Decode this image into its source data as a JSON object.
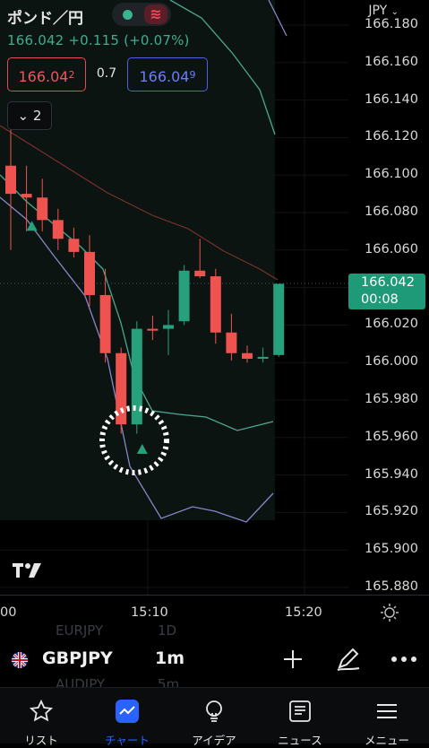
{
  "header": {
    "title": "ポンド／円",
    "price": "166.042",
    "change": "+0.115 (+0.07%)",
    "currency": "JPY",
    "sell_price": "166.04",
    "sell_price_sup": "2",
    "spread": "0.7",
    "buy_price": "166.04",
    "buy_price_sup": "9",
    "indicators_count": "2"
  },
  "colors": {
    "up": "#26a17b",
    "down": "#ef5350",
    "band_upper": "#4aa891",
    "band_lower": "#8b85c8",
    "mid": "#7a3030",
    "accent": "#2962ff"
  },
  "price_axis": {
    "ticks": [
      "166.180",
      "166.160",
      "166.140",
      "166.120",
      "166.100",
      "166.080",
      "166.060",
      "166.040",
      "166.020",
      "166.000",
      "165.980",
      "165.960",
      "165.940",
      "165.920",
      "165.900",
      "165.880"
    ],
    "current_price": "166.042",
    "countdown": "00:08"
  },
  "time_axis": {
    "ticks": [
      "00",
      "15:10",
      "15:20"
    ]
  },
  "toolbar": {
    "symbol": "GBPJPY",
    "interval": "1m",
    "ghost_symbol_above": "EURJPY",
    "ghost_interval_above": "1D",
    "ghost_symbol_below": "AUDJPY",
    "ghost_interval_below": "5m"
  },
  "tabs": [
    {
      "label": "リスト",
      "icon": "star-icon"
    },
    {
      "label": "チャート",
      "icon": "chart-icon",
      "active": true
    },
    {
      "label": "アイデア",
      "icon": "lightbulb-icon"
    },
    {
      "label": "ニュース",
      "icon": "news-icon"
    },
    {
      "label": "メニュー",
      "icon": "menu-icon"
    }
  ],
  "chart_data": {
    "type": "candlestick",
    "interval": "1m",
    "ylim": [
      165.875,
      166.185
    ],
    "candles": [
      {
        "o": 166.105,
        "h": 166.125,
        "l": 166.06,
        "c": 166.09
      },
      {
        "o": 166.09,
        "h": 166.105,
        "l": 166.07,
        "c": 166.088
      },
      {
        "o": 166.088,
        "h": 166.098,
        "l": 166.07,
        "c": 166.076
      },
      {
        "o": 166.076,
        "h": 166.082,
        "l": 166.06,
        "c": 166.066
      },
      {
        "o": 166.066,
        "h": 166.072,
        "l": 166.056,
        "c": 166.059
      },
      {
        "o": 166.059,
        "h": 166.068,
        "l": 166.03,
        "c": 166.036
      },
      {
        "o": 166.036,
        "h": 166.05,
        "l": 166.0,
        "c": 166.005
      },
      {
        "o": 166.005,
        "h": 166.008,
        "l": 165.962,
        "c": 165.967
      },
      {
        "o": 165.967,
        "h": 166.022,
        "l": 165.962,
        "c": 166.018
      },
      {
        "o": 166.018,
        "h": 166.025,
        "l": 166.012,
        "c": 166.017
      },
      {
        "o": 166.018,
        "h": 166.028,
        "l": 166.004,
        "c": 166.02
      },
      {
        "o": 166.022,
        "h": 166.052,
        "l": 166.02,
        "c": 166.049
      },
      {
        "o": 166.049,
        "h": 166.066,
        "l": 166.045,
        "c": 166.046
      },
      {
        "o": 166.046,
        "h": 166.05,
        "l": 166.01,
        "c": 166.016
      },
      {
        "o": 166.016,
        "h": 166.026,
        "l": 166.001,
        "c": 166.005
      },
      {
        "o": 166.005,
        "h": 166.009,
        "l": 166.0,
        "c": 166.002
      },
      {
        "o": 166.002,
        "h": 166.008,
        "l": 166.0,
        "c": 166.003
      },
      {
        "o": 166.004,
        "h": 166.042,
        "l": 166.003,
        "c": 166.042
      }
    ],
    "signals": [
      "buy-arrow-1",
      "buy-arrow-8"
    ]
  }
}
